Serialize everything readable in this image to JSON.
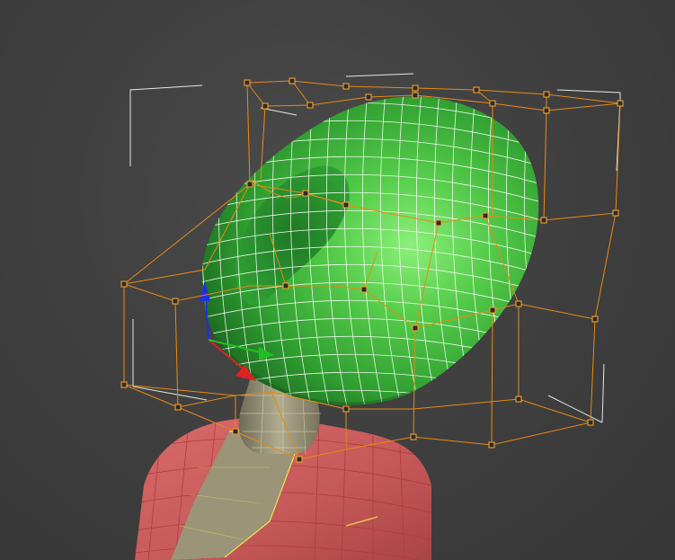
{
  "viewport": {
    "background": "#404040",
    "type": "3d-perspective-viewport"
  },
  "scene": {
    "object_color": "#3fbf3f",
    "ffd_cage_color": "#e88a14",
    "bounding_box_color": "#e6e6e6",
    "body_color": "#c85b5b",
    "neck_color": "#8f8a70",
    "gizmo": {
      "x_axis_color": "#e02020",
      "y_axis_color": "#20c020",
      "z_axis_color": "#2030e0"
    }
  }
}
